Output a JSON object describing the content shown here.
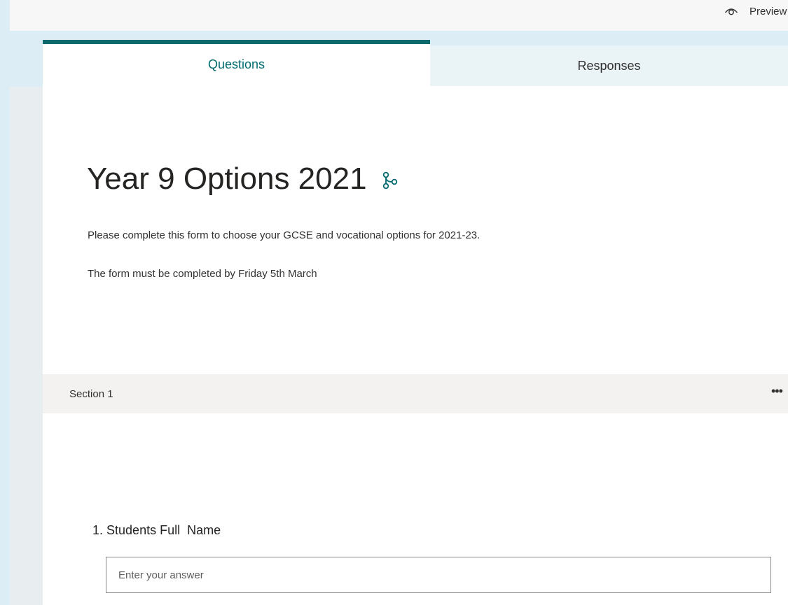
{
  "header": {
    "preview_label": "Preview",
    "preview_icon": "eye-icon"
  },
  "tabs": [
    {
      "label": "Questions",
      "active": true
    },
    {
      "label": "Responses",
      "active": false
    }
  ],
  "form": {
    "title": "Year 9 Options 2021",
    "branch_icon": "branching-icon",
    "description_lines": [
      "Please complete this form to choose your GCSE and vocational options for 2021-23.",
      "The form must be completed by Friday 5th March"
    ]
  },
  "section": {
    "label": "Section 1",
    "more_icon": "more-options-icon"
  },
  "questions": [
    {
      "number": "1.",
      "text": "Students Full  Name",
      "placeholder": "Enter your answer"
    }
  ],
  "colors": {
    "accent": "#0b6a6d",
    "accent_text": "#036c70",
    "page_background": "#dcedf5",
    "section_bar": "#f3f2f1"
  }
}
